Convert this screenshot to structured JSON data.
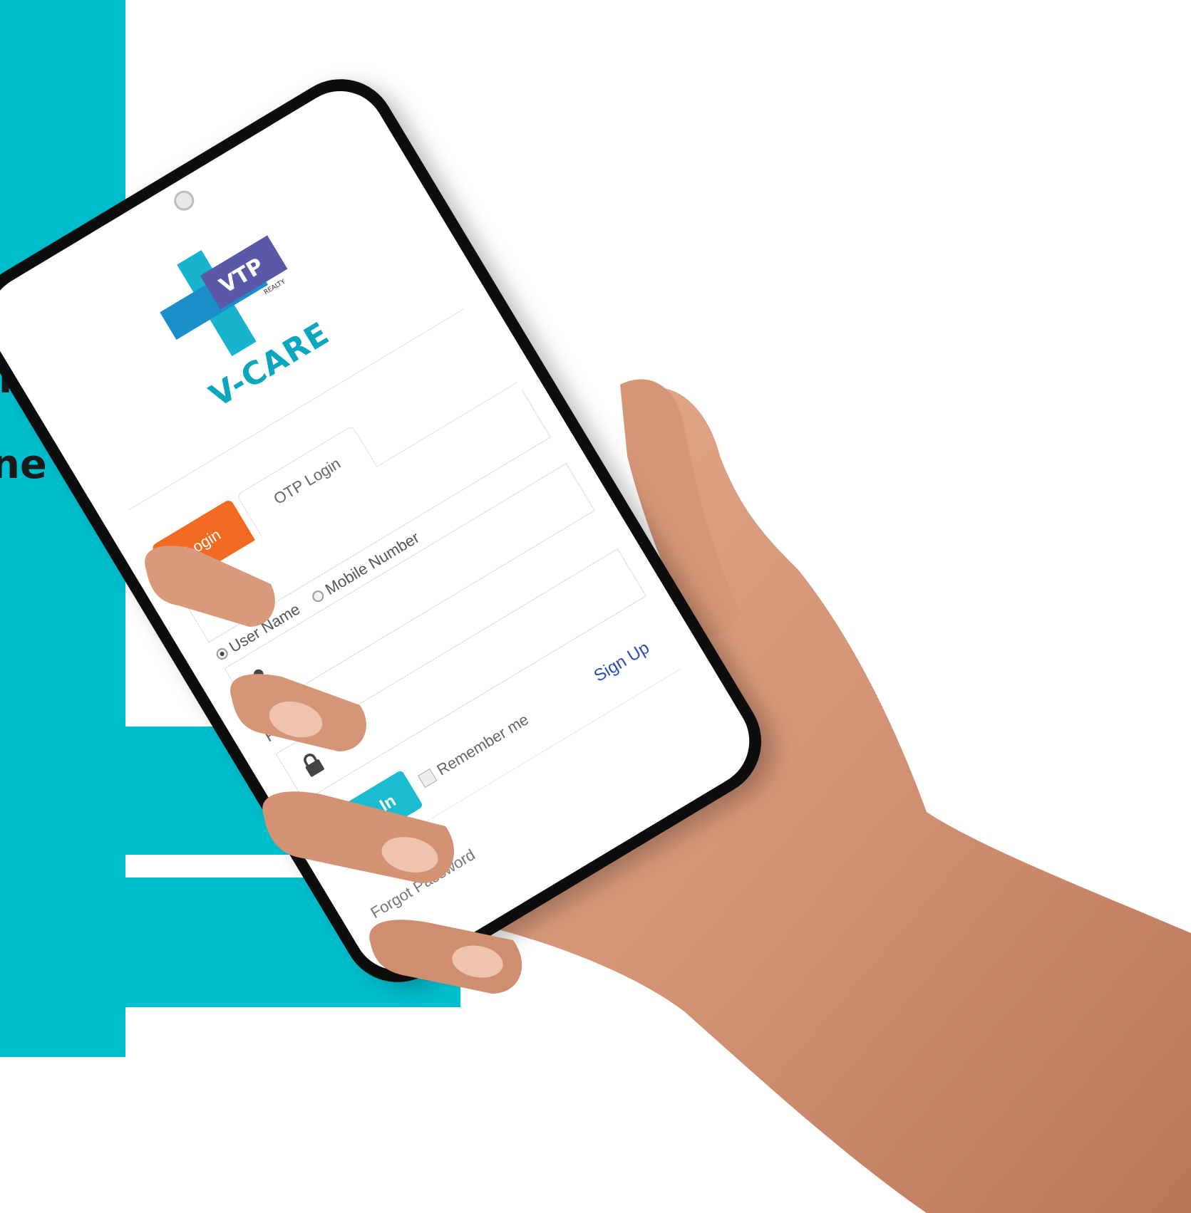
{
  "brand": {
    "logo_text": "VTP",
    "logo_subtext": "REALTY",
    "app_name": "V-CARE"
  },
  "background": {
    "left_text_fragment_1": "rs",
    "left_text_fragment_2": "ne",
    "accent_color": "#00c0d0"
  },
  "login": {
    "tabs": [
      {
        "label": "Login",
        "active": true
      },
      {
        "label": "OTP Login",
        "active": false
      }
    ],
    "login_type_options": [
      {
        "label": "User Name",
        "selected": true
      },
      {
        "label": "Mobile Number",
        "selected": false
      }
    ],
    "username_value": "",
    "password_label": "Password",
    "password_value": "",
    "sign_in_label": "Sign In",
    "remember_me_label": "Remember me",
    "sign_up_label": "Sign Up",
    "forgot_password_label": "Forgot Password",
    "colors": {
      "active_tab": "#f26a21",
      "sign_in": "#1bbccf",
      "link": "#2b4fb0"
    }
  },
  "icons": {
    "user": "user-icon",
    "lock": "lock-icon"
  }
}
